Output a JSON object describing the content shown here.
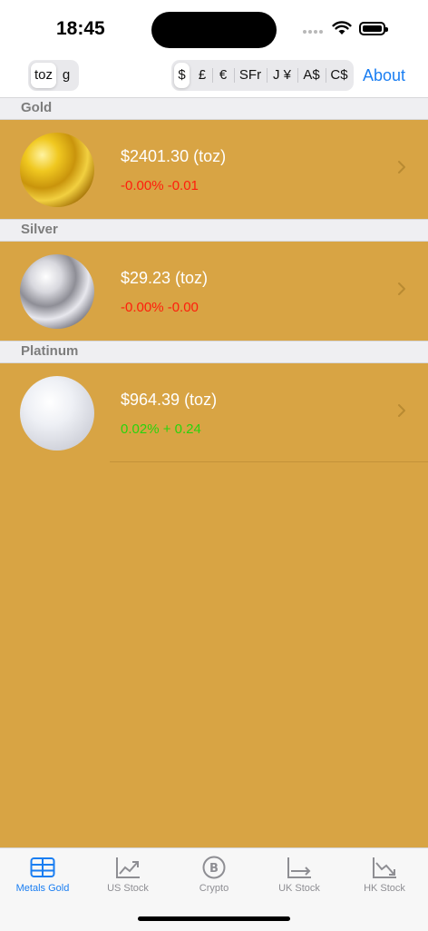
{
  "status_bar": {
    "time": "18:45"
  },
  "toolbar": {
    "unit_options": [
      "toz",
      "g"
    ],
    "unit_selected": "toz",
    "currency_options": [
      "$",
      "£",
      "€",
      "SFr",
      "J ¥",
      "A$",
      "C$"
    ],
    "currency_selected": "$",
    "about_label": "About"
  },
  "sections": [
    {
      "header": "Gold",
      "price": "$2401.30 (toz)",
      "change": "-0.00% -0.01",
      "direction": "down",
      "image": "gold-texture",
      "change_color": "#ff1d0c"
    },
    {
      "header": "Silver",
      "price": "$29.23 (toz)",
      "change": "-0.00% -0.00",
      "direction": "down",
      "image": "silver-texture",
      "change_color": "#ff1d0c"
    },
    {
      "header": "Platinum",
      "price": "$964.39 (toz)",
      "change": "0.02% + 0.24",
      "direction": "up",
      "image": "platinum-texture",
      "change_color": "#28d40c"
    }
  ],
  "tabs": [
    {
      "label": "Metals Gold",
      "icon": "table-icon",
      "active": true
    },
    {
      "label": "US Stock",
      "icon": "chart-up-icon",
      "active": false
    },
    {
      "label": "Crypto",
      "icon": "bitcoin-icon",
      "active": false
    },
    {
      "label": "UK Stock",
      "icon": "chart-flat-icon",
      "active": false
    },
    {
      "label": "HK Stock",
      "icon": "chart-down-icon",
      "active": false
    }
  ],
  "colors": {
    "background": "#d8a444",
    "accent": "#1a7ef2",
    "negative": "#ff1d0c",
    "positive": "#28d40c",
    "tab_inactive": "#8e8e93"
  }
}
